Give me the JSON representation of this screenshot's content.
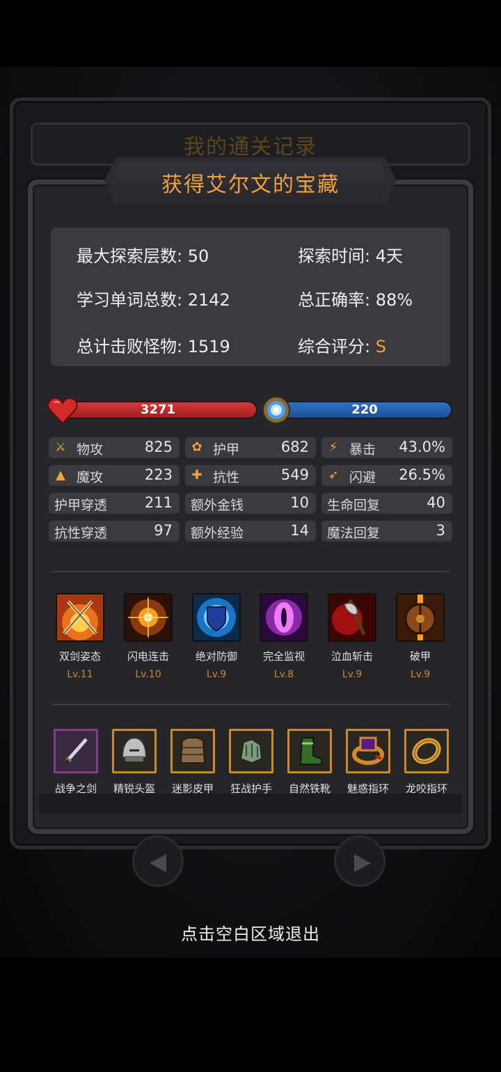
{
  "background_title": "我的通关记录",
  "title": "获得艾尔文的宝藏",
  "records": [
    {
      "label": "最大探索层数: ",
      "value": "50"
    },
    {
      "label": "探索时间: ",
      "value": "4天"
    },
    {
      "label": "学习单词总数: ",
      "value": "2142"
    },
    {
      "label": "总正确率: ",
      "value": "88%"
    },
    {
      "label": "总计击败怪物: ",
      "value": "1519"
    },
    {
      "label": "综合评分: ",
      "value": "S"
    }
  ],
  "hp": {
    "value": "3271",
    "icon": "heart-icon",
    "color": "#c22828"
  },
  "mp": {
    "value": "220",
    "icon": "mana-orb-icon",
    "color": "#2566b3"
  },
  "attributes": [
    {
      "icon": "sword-icon",
      "label": "物攻",
      "value": "825"
    },
    {
      "icon": "paw-icon",
      "label": "护甲",
      "value": "682"
    },
    {
      "icon": "lightning-icon",
      "label": "暴击",
      "value": "43.0%"
    },
    {
      "icon": "magic-hat-icon",
      "label": "魔攻",
      "value": "223"
    },
    {
      "icon": "muscle-icon",
      "label": "抗性",
      "value": "549"
    },
    {
      "icon": "runner-icon",
      "label": "闪避",
      "value": "26.5%"
    },
    {
      "icon": "",
      "label": "护甲穿透",
      "value": "211"
    },
    {
      "icon": "",
      "label": "额外金钱",
      "value": "10"
    },
    {
      "icon": "",
      "label": "生命回复",
      "value": "40"
    },
    {
      "icon": "",
      "label": "抗性穿透",
      "value": "97"
    },
    {
      "icon": "",
      "label": "额外经验",
      "value": "14"
    },
    {
      "icon": "",
      "label": "魔法回复",
      "value": "3"
    }
  ],
  "skills": [
    {
      "name": "双剑姿态",
      "level": "Lv.11",
      "icon": "twin-swords-icon"
    },
    {
      "name": "闪电连击",
      "level": "Lv.10",
      "icon": "flash-icon"
    },
    {
      "name": "绝对防御",
      "level": "Lv.9",
      "icon": "shield-icon"
    },
    {
      "name": "完全监视",
      "level": "Lv.8",
      "icon": "eye-icon"
    },
    {
      "name": "泣血斩击",
      "level": "Lv.9",
      "icon": "bloody-axe-icon"
    },
    {
      "name": "破甲",
      "level": "Lv.9",
      "icon": "broken-shield-icon"
    }
  ],
  "equipment": [
    {
      "name": "战争之剑",
      "icon": "dagger-icon",
      "rarity": "purple"
    },
    {
      "name": "精锐头盔",
      "icon": "helmet-icon",
      "rarity": "gold"
    },
    {
      "name": "迷影皮甲",
      "icon": "leather-armor-icon",
      "rarity": "gold"
    },
    {
      "name": "狂战护手",
      "icon": "gauntlet-icon",
      "rarity": "gold"
    },
    {
      "name": "自然铁靴",
      "icon": "boots-icon",
      "rarity": "gold"
    },
    {
      "name": "魅惑指环",
      "icon": "ruby-ring-icon",
      "rarity": "gold"
    },
    {
      "name": "龙咬指环",
      "icon": "gold-ring-icon",
      "rarity": "gold"
    }
  ],
  "exit_hint": "点击空白区域退出",
  "colors": {
    "accent": "#f2a23c",
    "level": "#c98a2c",
    "panel": "#26262a"
  }
}
